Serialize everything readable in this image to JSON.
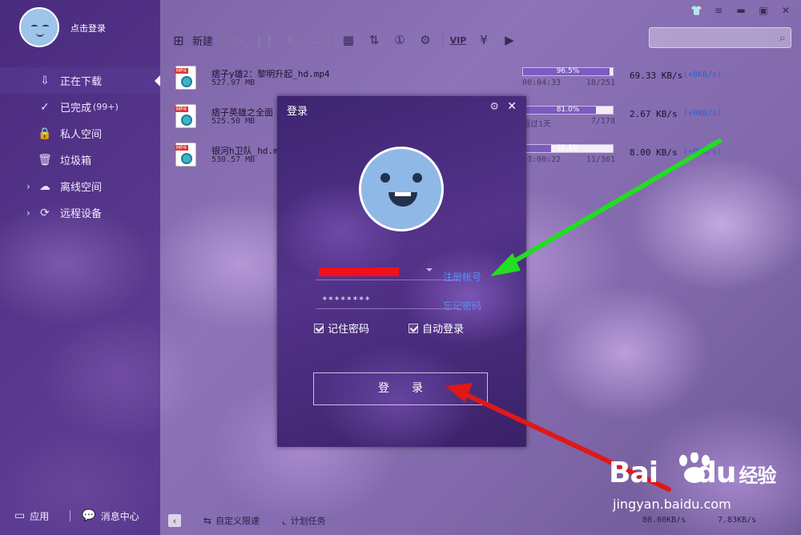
{
  "sidebar": {
    "login_prompt": "点击登录",
    "items": [
      {
        "label": "正在下载",
        "icon": "download-icon",
        "active": true
      },
      {
        "label": "已完成",
        "count": "(99+)",
        "icon": "check-circle-icon"
      },
      {
        "label": "私人空间",
        "icon": "lock-icon"
      },
      {
        "label": "垃圾箱",
        "icon": "trash-icon"
      },
      {
        "label": "离线空间",
        "icon": "cloud-icon",
        "expandable": true
      },
      {
        "label": "远程设备",
        "icon": "remote-device-icon",
        "expandable": true
      }
    ],
    "bottom": {
      "apps": "应用",
      "messages": "消息中心"
    }
  },
  "toolbar": {
    "new_label": "新建"
  },
  "downloads": [
    {
      "name": "痞子y雄2：黎明升起_hd.mp4",
      "size": "527.97 MB",
      "progress_text": "96.5%",
      "progress": 96.5,
      "elapsed": "00:04:33",
      "pieces": "18/251",
      "speed": "69.33 KB/s",
      "upload": "(+0KB/s)"
    },
    {
      "name": "痞子英雄之全面",
      "size": "525.50 MB",
      "progress_text": "81.0%",
      "progress": 81.0,
      "elapsed": "超过1天",
      "pieces": "7/178",
      "speed": "2.67  KB/s",
      "upload": "(+0KB/s)"
    },
    {
      "name": "银河h卫队_hd.m",
      "size": "530.57 MB",
      "progress_text": "31.1%",
      "progress": 31.1,
      "elapsed": "03:00:22",
      "pieces": "11/361",
      "speed": "8.00  KB/s",
      "upload": "(+0KB/s)"
    }
  ],
  "statusbar": {
    "speed_limit": "自定义限速",
    "schedule": "计划任务",
    "down_speed": "80.00KB/s",
    "up_speed": "7.83KB/s"
  },
  "dialog": {
    "title": "登录",
    "password_mask": "********",
    "register": "注册帐号",
    "forgot": "忘记密码",
    "remember": "记住密码",
    "auto_login": "自动登录",
    "login_button": "登录"
  },
  "watermark": {
    "brand_latin": "Bai",
    "brand_latin2": "du",
    "brand_cn": "经验",
    "url": "jingyan.baidu.com"
  },
  "colors": {
    "accent_purple": "#7d5bc0",
    "link_blue": "#5c8ff0",
    "arrow_green": "#22dd22",
    "arrow_red": "#e01818"
  }
}
